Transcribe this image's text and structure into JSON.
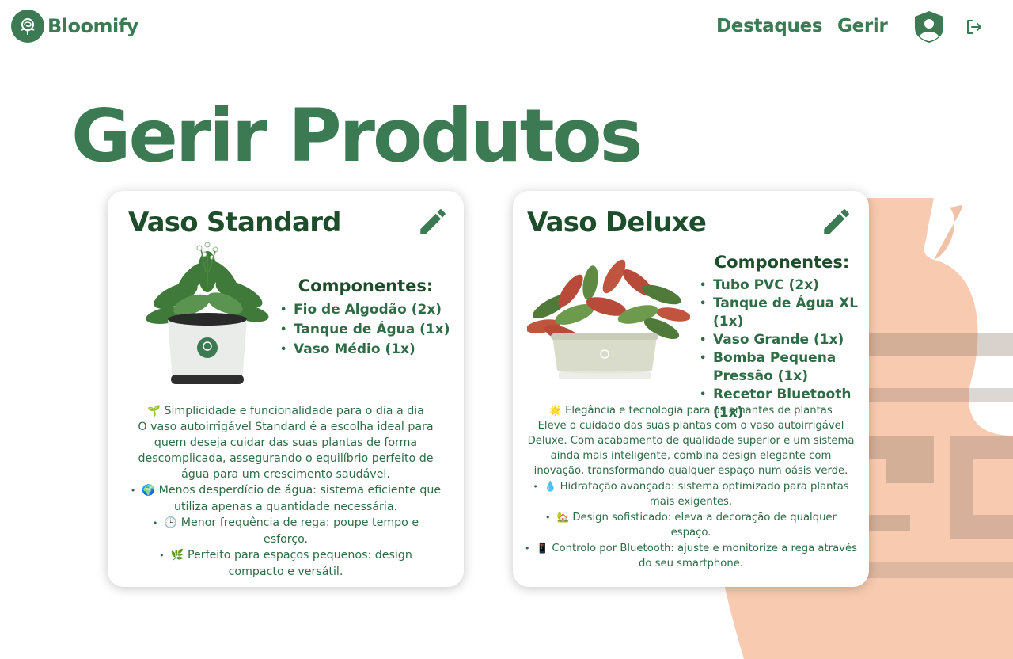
{
  "header": {
    "brand": "Bloomify",
    "nav": {
      "highlights": "Destaques",
      "manage": "Gerir"
    },
    "icons": {
      "logo": "rose-logo-icon",
      "profile": "user-shield-icon",
      "logout": "logout-icon"
    }
  },
  "page": {
    "title": "Gerir Produtos"
  },
  "products": [
    {
      "name": "Vaso Standard",
      "components_title": "Componentes:",
      "components": [
        "Fio de Algodão (2x)",
        "Tanque de Água (1x)",
        "Vaso Médio (1x)"
      ],
      "tagline_emoji": "🌱",
      "tagline": "Simplicidade e funcionalidade para o dia a dia",
      "description": "O vaso autoirrigável Standard é a escolha ideal para quem deseja cuidar das suas plantas de forma descomplicada, assegurando o equilíbrio perfeito de água para um crescimento saudável.",
      "features": [
        {
          "emoji": "🌍",
          "text": "Menos desperdício de água: sistema eficiente que utiliza apenas a quantidade necessária."
        },
        {
          "emoji": "🕒",
          "text": "Menor frequência de rega: poupe tempo e esforço."
        },
        {
          "emoji": "🌿",
          "text": "Perfeito para espaços pequenos: design compacto e versátil."
        }
      ]
    },
    {
      "name": "Vaso Deluxe",
      "components_title": "Componentes:",
      "components": [
        "Tubo PVC (2x)",
        "Tanque de Água XL (1x)",
        "Vaso Grande (1x)",
        "Bomba Pequena Pressão (1x)",
        "Recetor Bluetooth (1x)"
      ],
      "tagline_emoji": "🌟",
      "tagline": "Elegância e tecnologia para os amantes de plantas",
      "description": "Eleve o cuidado das suas plantas com o vaso autoirrigável Deluxe. Com acabamento de qualidade superior e um sistema ainda mais inteligente, combina design elegante com inovação, transformando qualquer espaço num oásis verde.",
      "features": [
        {
          "emoji": "💧",
          "text": "Hidratação avançada: sistema optimizado para plantas mais exigentes."
        },
        {
          "emoji": "🏡",
          "text": "Design sofisticado: eleva a decoração de qualquer espaço."
        },
        {
          "emoji": "📱",
          "text": "Controlo por Bluetooth: ajuste e monitorize a rega através do seu smartphone."
        }
      ]
    }
  ],
  "colors": {
    "brand_green": "#3b7a52",
    "dark_green": "#1e4d2b",
    "vase_orange": "#f2a57a"
  }
}
